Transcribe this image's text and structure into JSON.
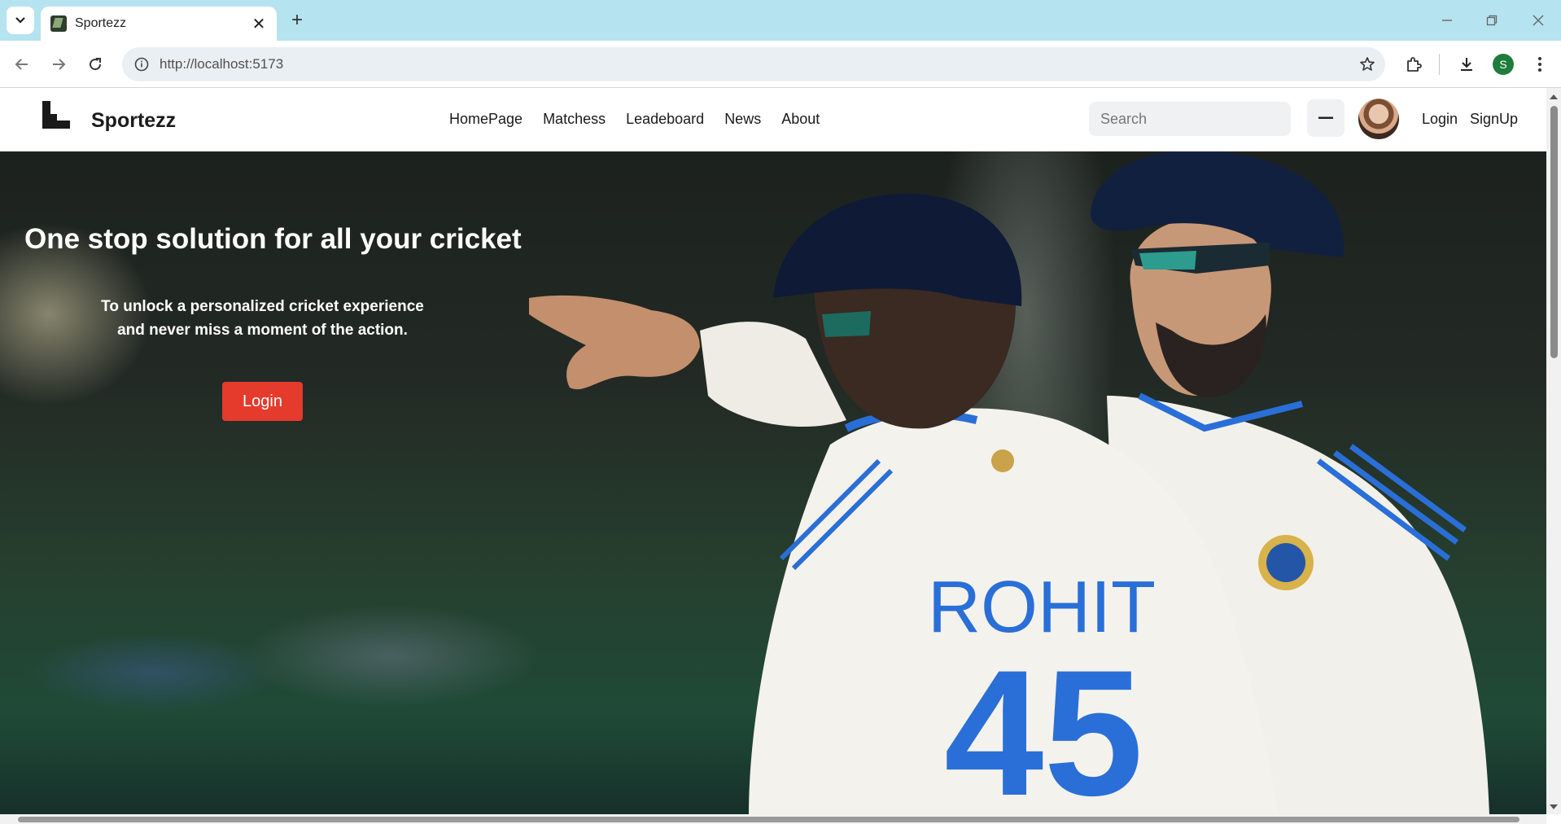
{
  "browser": {
    "tab_title": "Sportezz",
    "url": "http://localhost:5173",
    "profile_initial": "S",
    "icons": [
      "tab-list-icon",
      "close-icon",
      "plus-icon",
      "minimize-icon",
      "restore-icon",
      "window-close-icon",
      "back-icon",
      "forward-icon",
      "reload-icon",
      "info-icon",
      "star-icon",
      "extensions-icon",
      "download-icon",
      "more-icon"
    ]
  },
  "site": {
    "brand": "Sportezz",
    "nav": [
      "HomePage",
      "Matchess",
      "Leadeboard",
      "News",
      "About"
    ],
    "search_placeholder": "Search",
    "login": "Login",
    "signup": "SignUp"
  },
  "hero": {
    "title": "One stop solution for all your cricket",
    "subtitle_line1": "To unlock a personalized cricket experience",
    "subtitle_line2": "and never miss a moment of the action.",
    "button": "Login",
    "jersey_name": "ROHIT",
    "jersey_number": "45"
  },
  "colors": {
    "tabbar": "#b5e3ef",
    "login_button": "#e53b2c",
    "jersey_blue": "#2a6fd8"
  }
}
